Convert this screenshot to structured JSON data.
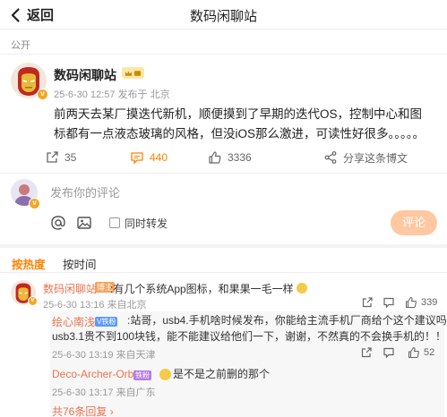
{
  "header": {
    "back_label": "返回",
    "title": "数码闲聊站"
  },
  "post": {
    "visibility": "公开",
    "author": "数码闲聊站",
    "time": "25-6-30 12:57",
    "source": "发布于 北京",
    "text": "前两天去某厂摸迭代新机，顺便摸到了早期的迭代OS，控制中心和图标都有一点液态玻璃的风格，但没iOS那么激进，可读性好很多。。。。。",
    "actions": {
      "repost": "35",
      "comments": "440",
      "likes": "3336",
      "share": "分享这条博文"
    }
  },
  "composer": {
    "placeholder": "发布你的评论",
    "repost_label": "同时转发",
    "submit_label": "评论"
  },
  "sort_tabs": {
    "hot": "按热度",
    "time": "按时间"
  },
  "comment": {
    "author": "数码闲聊站",
    "author_tag": "博主",
    "text": ":有几个系统App图标，和果果一毛一样",
    "time": "25-6-30 13:16",
    "location": "来自北京",
    "likes": "339"
  },
  "replies": [
    {
      "author": "绘心南浅",
      "badge": "V铁粉",
      "text_line1": ":站哥，usb4.手机啥时候发布，你能给主流手机厂商给个这个建议吗，比",
      "text_line2": "usb3.1贵不到100块钱，能不能建议给他们一下，谢谢，不然真的不会换手机的！！！",
      "time": "25-6-30 13:19",
      "location": "来自天津",
      "likes": "52"
    },
    {
      "author": "Deco-Archer-Orbi",
      "badge": "铁粉",
      "text": "是不是之前删的那个",
      "time": "25-6-30 13:17",
      "location": "来自广东"
    }
  ],
  "more_replies": "共76条回复",
  "colors": {
    "accent": "#ff8200",
    "link": "#eb7350",
    "submit_bg": "#ffc8a1"
  }
}
